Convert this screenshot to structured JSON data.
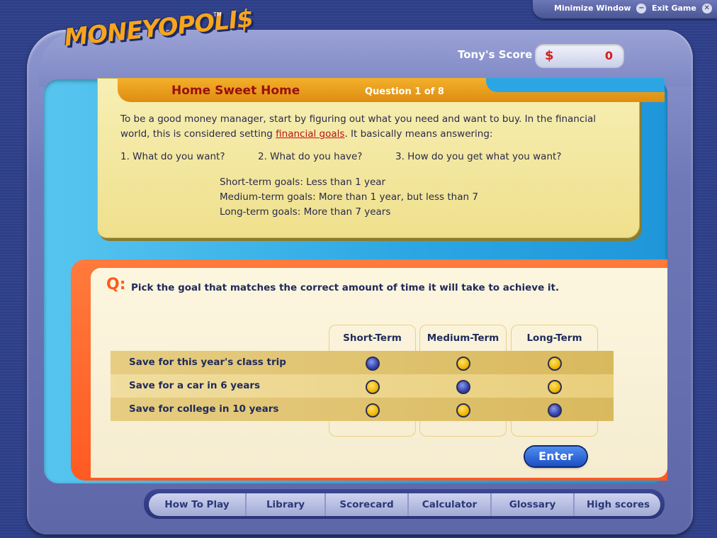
{
  "window_bar": {
    "minimize_label": "Minimize Window",
    "minimize_symbol": "−",
    "exit_label": "Exit Game",
    "exit_symbol": "✕"
  },
  "logo": {
    "text": "MONEYOPOLI$",
    "tm": "TM"
  },
  "score": {
    "label": "Tony's Score",
    "currency": "$",
    "value": "0"
  },
  "card": {
    "title": "Home Sweet Home",
    "question_number": "Question 1 of 8",
    "intro_part1": "To be a good money manager, start by figuring out what you need and want to buy. In the financial",
    "intro_part2_before": "world, this is considered setting ",
    "intro_link": "financial goals",
    "intro_part2_after": ". It basically means answering:",
    "steps": [
      "1. What do you want?",
      "2. What do you have?",
      "3. How do you get what you want?"
    ],
    "goals": [
      "Short-term goals: Less than 1 year",
      "Medium-term goals: More than 1 year, but less than 7",
      "Long-term goals: More than 7 years"
    ]
  },
  "question": {
    "marker": "Q:",
    "text": "Pick the goal that matches the correct amount of time it will take to achieve it.",
    "columns": [
      "Short-Term",
      "Medium-Term",
      "Long-Term"
    ],
    "rows": [
      {
        "label": "Save for this year's class trip",
        "selected_column": 0
      },
      {
        "label": "Save for a car in 6 years",
        "selected_column": 1
      },
      {
        "label": "Save for college in 10 years",
        "selected_column": 2
      }
    ],
    "enter_label": "Enter"
  },
  "nav": {
    "items": [
      "How To Play",
      "Library",
      "Scorecard",
      "Calculator",
      "Glossary",
      "High scores"
    ]
  },
  "colors": {
    "accent_orange": "#ff5a22",
    "title_red": "#9a1010",
    "link_red": "#b81414",
    "selected_radio": "#3344b0",
    "unselected_radio": "#f0b800"
  }
}
